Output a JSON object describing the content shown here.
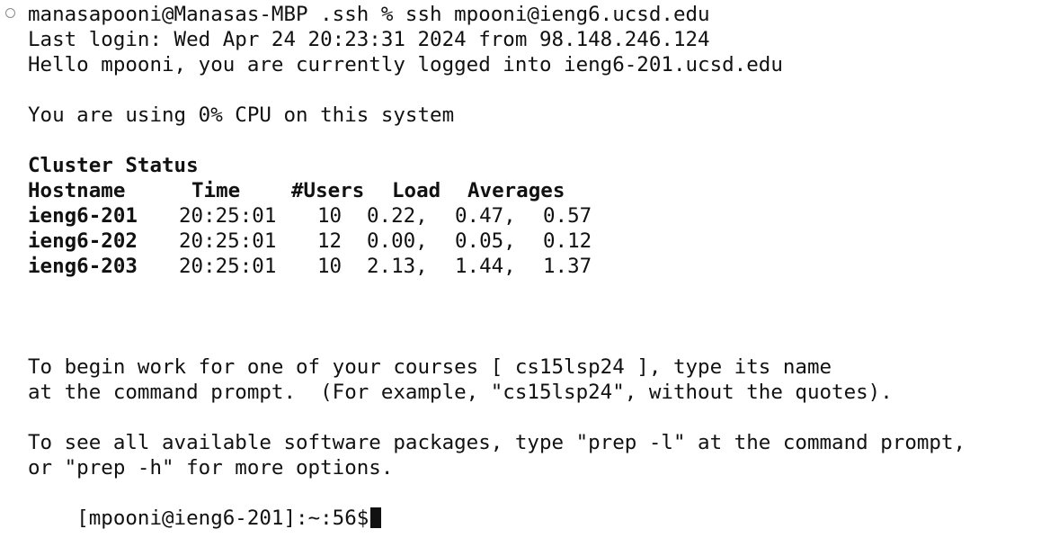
{
  "session": {
    "command_line": "manasapooni@Manasas-MBP .ssh % ssh mpooni@ieng6.ucsd.edu",
    "last_login": "Last login: Wed Apr 24 20:23:31 2024 from 98.148.246.124",
    "hello": "Hello mpooni, you are currently logged into ieng6-201.ucsd.edu",
    "cpu": "You are using 0% CPU on this system"
  },
  "cluster": {
    "title": "Cluster Status",
    "headers": [
      "Hostname",
      "Time",
      "#Users",
      "Load",
      "Averages"
    ],
    "rows": [
      {
        "host": "ieng6-201",
        "time": "20:25:01",
        "users": "10",
        "load": "0.22,",
        "avg5": "0.47,",
        "avg15": "0.57"
      },
      {
        "host": "ieng6-202",
        "time": "20:25:01",
        "users": "12",
        "load": "0.00,",
        "avg5": "0.05,",
        "avg15": "0.12"
      },
      {
        "host": "ieng6-203",
        "time": "20:25:01",
        "users": "10",
        "load": "2.13,",
        "avg5": "1.44,",
        "avg15": "1.37"
      }
    ]
  },
  "info": {
    "courses_line1": "To begin work for one of your courses [ cs15lsp24 ], type its name",
    "courses_line2": "at the command prompt.  (For example, \"cs15lsp24\", without the quotes).",
    "prep_line1": "To see all available software packages, type \"prep -l\" at the command prompt,",
    "prep_line2": "or \"prep -h\" for more options."
  },
  "prompt": {
    "text": "[mpooni@ieng6-201]:~:56$"
  }
}
